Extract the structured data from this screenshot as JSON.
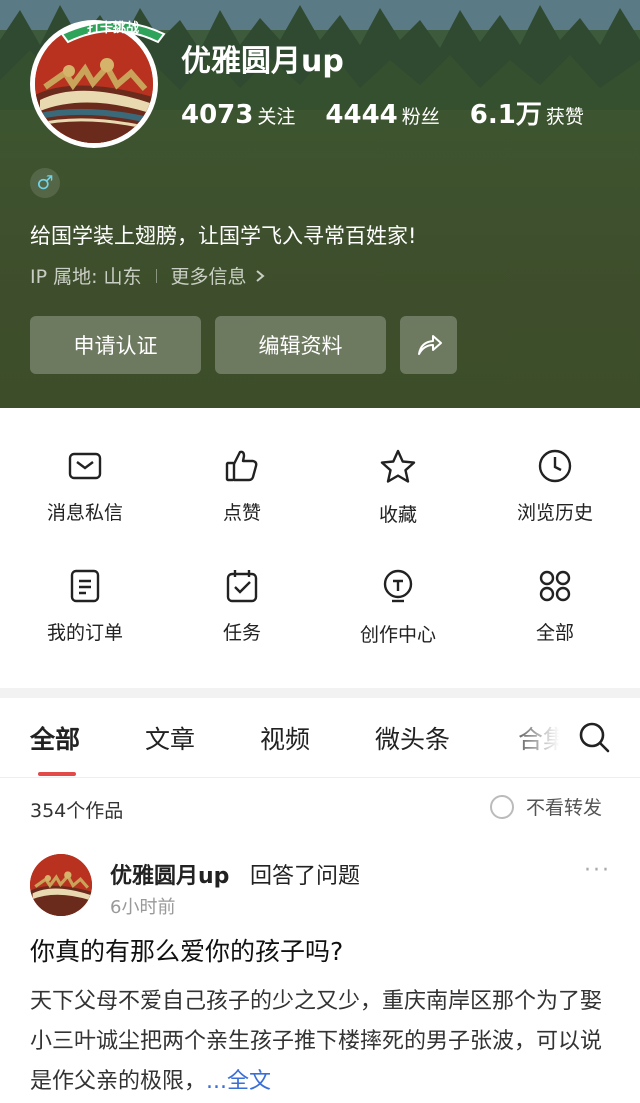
{
  "profile": {
    "username": "优雅圆月up",
    "badge_text": "打卡挑战",
    "stats": [
      {
        "num": "4073",
        "label": "关注"
      },
      {
        "num": "4444",
        "label": "粉丝"
      },
      {
        "num": "6.1万",
        "label": "获赞"
      }
    ],
    "gender_symbol": "♂",
    "bio": "给国学装上翅膀，让国学飞入寻常百姓家!",
    "ip_location": "IP 属地: 山东",
    "more_info": "更多信息",
    "buttons": {
      "verify": "申请认证",
      "edit": "编辑资料"
    }
  },
  "quick_menu": [
    {
      "label": "消息私信",
      "icon": "mail-icon"
    },
    {
      "label": "点赞",
      "icon": "thumbs-up-icon"
    },
    {
      "label": "收藏",
      "icon": "star-icon"
    },
    {
      "label": "浏览历史",
      "icon": "clock-icon"
    },
    {
      "label": "我的订单",
      "icon": "order-icon"
    },
    {
      "label": "任务",
      "icon": "calendar-check-icon"
    },
    {
      "label": "创作中心",
      "icon": "lightbulb-icon"
    },
    {
      "label": "全部",
      "icon": "grid-icon"
    }
  ],
  "tabs": [
    "全部",
    "文章",
    "视频",
    "微头条",
    "合集"
  ],
  "works": {
    "count_text": "354个作品",
    "filter_label": "不看转发"
  },
  "post": {
    "author": "优雅圆月up",
    "action": "回答了问题",
    "time": "6小时前",
    "more_glyph": "···",
    "title": "你真的有那么爱你的孩子吗?",
    "body": "天下父母不爱自己孩子的少之又少，重庆南岸区那个为了娶小三叶诚尘把两个亲生孩子推下楼摔死的男子张波，可以说是作父亲的极限，",
    "ellipsis": "...",
    "read_more": "全文"
  },
  "colors": {
    "accent": "#e24a4a",
    "header_bg": "#3d4f2c",
    "link": "#3a6fd8"
  }
}
